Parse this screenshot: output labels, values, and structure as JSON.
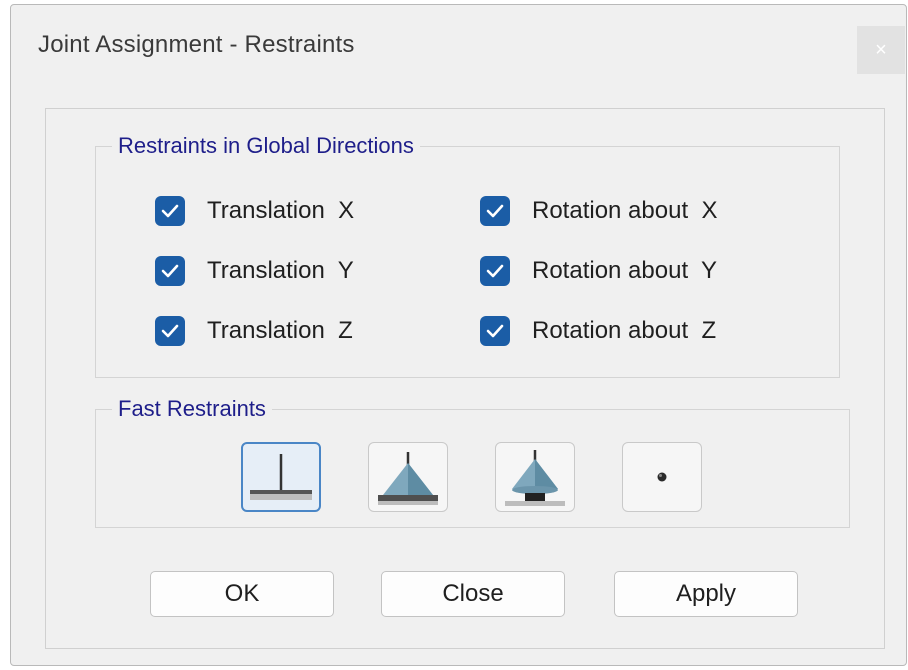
{
  "window": {
    "title": "Joint Assignment - Restraints",
    "close_glyph": "×"
  },
  "restraints_group": {
    "legend": "Restraints in Global Directions",
    "checkboxes": [
      {
        "label": "Translation  X",
        "checked": true
      },
      {
        "label": "Translation  Y",
        "checked": true
      },
      {
        "label": "Translation  Z",
        "checked": true
      },
      {
        "label": "Rotation about  X",
        "checked": true
      },
      {
        "label": "Rotation about  Y",
        "checked": true
      },
      {
        "label": "Rotation about  Z",
        "checked": true
      }
    ]
  },
  "fast_restraints_group": {
    "legend": "Fast Restraints",
    "buttons": [
      {
        "icon": "fixed-support-icon",
        "selected": true
      },
      {
        "icon": "pinned-support-icon",
        "selected": false
      },
      {
        "icon": "roller-support-icon",
        "selected": false
      },
      {
        "icon": "free-joint-icon",
        "selected": false
      }
    ]
  },
  "footer_buttons": {
    "ok": "OK",
    "close": "Close",
    "apply": "Apply"
  },
  "colors": {
    "checkbox_fill": "#1b5da6",
    "group_legend_text": "#1e1e8a",
    "selected_tool_border": "#4a86c6"
  }
}
